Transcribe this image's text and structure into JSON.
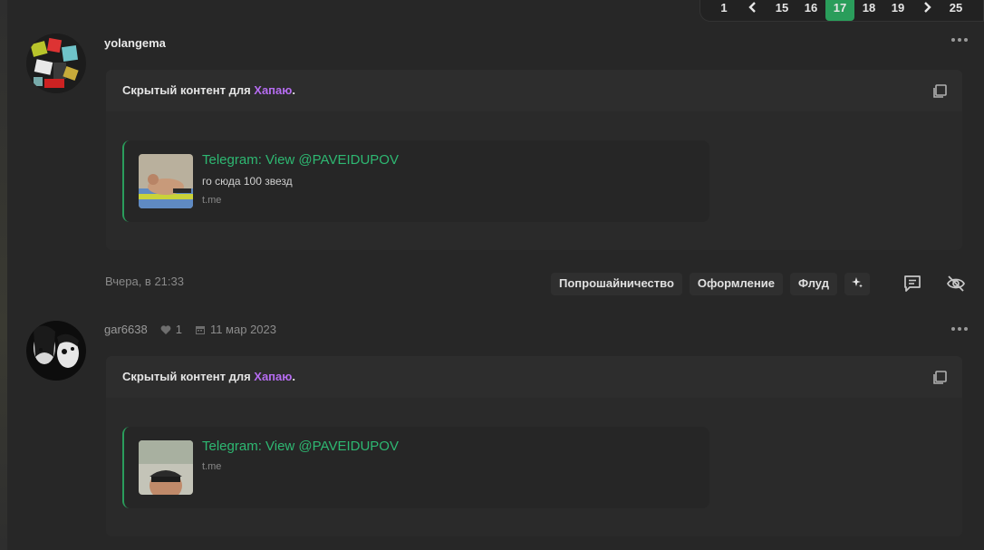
{
  "pagination": {
    "pages": [
      "1",
      "15",
      "16",
      "17",
      "18",
      "19",
      "25"
    ],
    "active": "17"
  },
  "posts": [
    {
      "author": "yolangema",
      "hidden_prefix": "Скрытый контент для ",
      "hidden_group": "Хапаю",
      "hidden_suffix": ".",
      "embed": {
        "title": "Telegram: View @PAVEIDUPOV",
        "description": "го сюда 100 звезд",
        "domain": "t.me"
      },
      "date": "Вчера, в 21:33",
      "tags": [
        "Попрошайничество",
        "Оформление",
        "Флуд"
      ]
    },
    {
      "author": "gar6638",
      "likes": "1",
      "joined": "11 мар 2023",
      "hidden_prefix": "Скрытый контент для ",
      "hidden_group": "Хапаю",
      "hidden_suffix": ".",
      "embed": {
        "title": "Telegram: View @PAVEIDUPOV",
        "domain": "t.me"
      }
    }
  ],
  "icons": {
    "prev": "chevron-left-icon",
    "next": "chevron-right-icon",
    "more": "ellipsis-icon",
    "copy": "copy-icon",
    "sparkle": "sparkle-icon",
    "comment": "comment-icon",
    "hide": "eye-off-icon",
    "heart": "heart-icon",
    "calendar": "calendar-icon"
  },
  "colors": {
    "accent_green": "#2a9d5b",
    "link_green": "#2eb872",
    "group_purple": "#b56cf0"
  }
}
